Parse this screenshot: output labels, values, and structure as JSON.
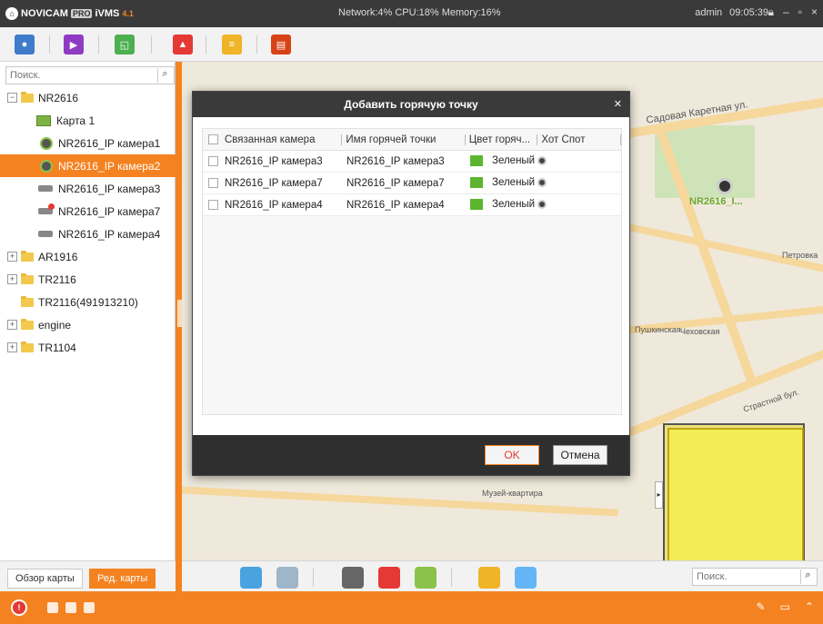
{
  "titlebar": {
    "brand": "NOVICAM",
    "pro": "PRO",
    "product": "iVMS",
    "version": "4.1",
    "network": "Network:4%",
    "cpu": "CPU:18%",
    "memory": "Memory:16%",
    "user": "admin",
    "time": "09:05:39"
  },
  "left_panel": {
    "search_placeholder": "Поиск.",
    "tree": [
      {
        "label": "NR2616",
        "level": 0,
        "expanded": true,
        "type": "folder"
      },
      {
        "label": "Карта 1",
        "level": 1,
        "type": "map"
      },
      {
        "label": "NR2616_IP камера1",
        "level": 1,
        "type": "camera-online"
      },
      {
        "label": "NR2616_IP камера2",
        "level": 1,
        "type": "camera-online",
        "selected": true
      },
      {
        "label": "NR2616_IP камера3",
        "level": 1,
        "type": "camera"
      },
      {
        "label": "NR2616_IP камера7",
        "level": 1,
        "type": "camera-alarm"
      },
      {
        "label": "NR2616_IP камера4",
        "level": 1,
        "type": "camera"
      },
      {
        "label": "AR1916",
        "level": 0,
        "expanded": false,
        "type": "folder"
      },
      {
        "label": "TR2116",
        "level": 0,
        "expanded": false,
        "type": "folder"
      },
      {
        "label": "TR2116(491913210)",
        "level": 0,
        "type": "folder-noexp"
      },
      {
        "label": "engine",
        "level": 0,
        "expanded": false,
        "type": "folder"
      },
      {
        "label": "TR1104",
        "level": 0,
        "expanded": false,
        "type": "folder"
      }
    ],
    "tab_overview": "Обзор карты",
    "tab_edit": "Ред. карты"
  },
  "map": {
    "labels": [
      "Садовая Каретная ул.",
      "NR2616_I...",
      "Чеховская",
      "Пушкинская",
      "Страстной бул.",
      "Петровка",
      "Музей-квартира"
    ],
    "search_placeholder": "Поиск."
  },
  "dialog": {
    "title": "Добавить горячую точку",
    "columns": [
      "Связанная камера",
      "Имя горячей точки",
      "Цвет горяч...",
      "Хот Спот"
    ],
    "rows": [
      {
        "camera": "NR2616_IP камера3",
        "name": "NR2616_IP камера3",
        "color": "Зеленый"
      },
      {
        "camera": "NR2616_IP камера7",
        "name": "NR2616_IP камера7",
        "color": "Зеленый"
      },
      {
        "camera": "NR2616_IP камера4",
        "name": "NR2616_IP камера4",
        "color": "Зеленый"
      }
    ],
    "ok": "OK",
    "cancel": "Отмена"
  },
  "colors": {
    "accent": "#f58220",
    "titlebar": "#3a3a3a",
    "hotspot_green": "#5cb52e"
  }
}
